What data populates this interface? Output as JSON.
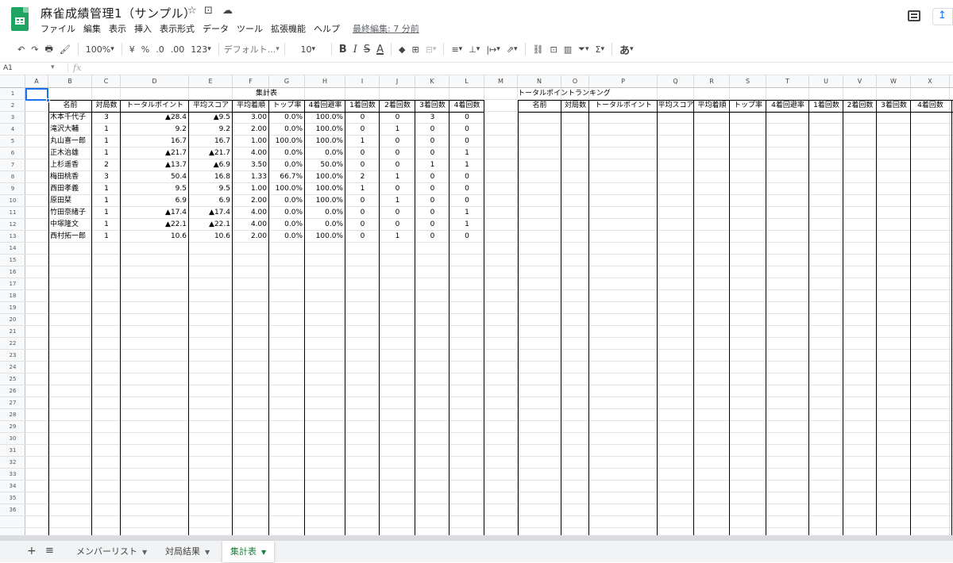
{
  "document": {
    "title": "麻雀成績管理1（サンプル）",
    "last_edit": "最終編集: 7 分前",
    "title_icons": [
      "star-icon",
      "move-to-folder-icon",
      "cloud-status-icon"
    ]
  },
  "menu": [
    "ファイル",
    "編集",
    "表示",
    "挿入",
    "表示形式",
    "データ",
    "ツール",
    "拡張機能",
    "ヘルプ"
  ],
  "toolbar": {
    "undo": "↶",
    "redo": "↷",
    "print": "🖶",
    "paint_format": "🖌",
    "zoom": "100%",
    "currency": "¥",
    "percent": "%",
    "decrease_decimal": ".0",
    "increase_decimal": ".00",
    "number_format": "123",
    "font": "デフォルト...",
    "font_size": "10",
    "bold": "B",
    "italic": "I",
    "strike": "S",
    "text_color": "A",
    "fill": "◆",
    "borders": "⊞",
    "merge": "⊟",
    "halign": "≡",
    "valign": "⊥",
    "wrap": "|↦",
    "rotate": "⇗",
    "link": "⛓",
    "comment": "⊡",
    "chart": "▥",
    "filter": "⏷",
    "functions": "Σ",
    "input_tools": "あ"
  },
  "formula_bar": {
    "name_box": "A1",
    "fx": "fx",
    "content": ""
  },
  "columns": [
    "A",
    "B",
    "C",
    "D",
    "E",
    "F",
    "G",
    "H",
    "I",
    "J",
    "K",
    "L",
    "M",
    "N",
    "O",
    "P",
    "Q",
    "R",
    "S",
    "T",
    "U",
    "V",
    "W",
    "X"
  ],
  "row_count": 36,
  "summary_table": {
    "title": "集計表",
    "headers": [
      "名前",
      "対局数",
      "トータルポイント",
      "平均スコア",
      "平均着順",
      "トップ率",
      "4着回避率",
      "1着回数",
      "2着回数",
      "3着回数",
      "4着回数"
    ],
    "rows": [
      [
        "木本千代子",
        "3",
        "▲28.4",
        "▲9.5",
        "3.00",
        "0.0%",
        "100.0%",
        "0",
        "0",
        "3",
        "0"
      ],
      [
        "滝沢大輔",
        "1",
        "9.2",
        "9.2",
        "2.00",
        "0.0%",
        "100.0%",
        "0",
        "1",
        "0",
        "0"
      ],
      [
        "丸山喜一郎",
        "1",
        "16.7",
        "16.7",
        "1.00",
        "100.0%",
        "100.0%",
        "1",
        "0",
        "0",
        "0"
      ],
      [
        "正木治雄",
        "1",
        "▲21.7",
        "▲21.7",
        "4.00",
        "0.0%",
        "0.0%",
        "0",
        "0",
        "0",
        "1"
      ],
      [
        "上杉遥香",
        "2",
        "▲13.7",
        "▲6.9",
        "3.50",
        "0.0%",
        "50.0%",
        "0",
        "0",
        "1",
        "1"
      ],
      [
        "梅田桃香",
        "3",
        "50.4",
        "16.8",
        "1.33",
        "66.7%",
        "100.0%",
        "2",
        "1",
        "0",
        "0"
      ],
      [
        "西田孝義",
        "1",
        "9.5",
        "9.5",
        "1.00",
        "100.0%",
        "100.0%",
        "1",
        "0",
        "0",
        "0"
      ],
      [
        "原田栞",
        "1",
        "6.9",
        "6.9",
        "2.00",
        "0.0%",
        "100.0%",
        "0",
        "1",
        "0",
        "0"
      ],
      [
        "竹田奈緒子",
        "1",
        "▲17.4",
        "▲17.4",
        "4.00",
        "0.0%",
        "0.0%",
        "0",
        "0",
        "0",
        "1"
      ],
      [
        "中塚隆文",
        "1",
        "▲22.1",
        "▲22.1",
        "4.00",
        "0.0%",
        "0.0%",
        "0",
        "0",
        "0",
        "1"
      ],
      [
        "西村拓一郎",
        "1",
        "10.6",
        "10.6",
        "2.00",
        "0.0%",
        "100.0%",
        "0",
        "1",
        "0",
        "0"
      ]
    ]
  },
  "ranking_table": {
    "title": "トータルポイントランキング",
    "headers": [
      "名前",
      "対局数",
      "トータルポイント",
      "平均スコア",
      "平均着順",
      "トップ率",
      "4着回避率",
      "1着回数",
      "2着回数",
      "3着回数",
      "4着回数"
    ]
  },
  "sheets": [
    {
      "label": "メンバーリスト",
      "active": false
    },
    {
      "label": "対局結果",
      "active": false
    },
    {
      "label": "集計表",
      "active": true
    }
  ],
  "sheet_controls": {
    "add": "+",
    "all": "≡"
  }
}
